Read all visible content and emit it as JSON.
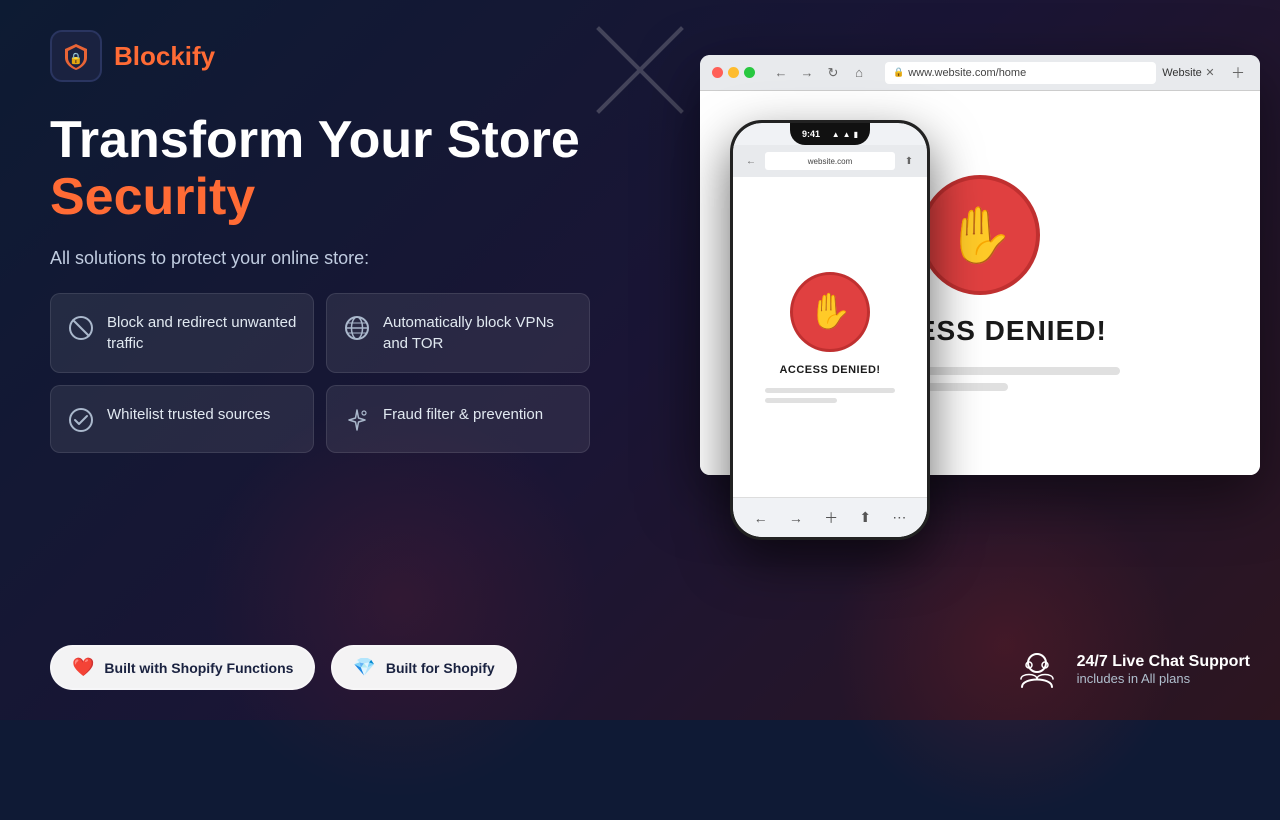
{
  "brand": {
    "name": "Blockify",
    "logo_alt": "Blockify Logo"
  },
  "hero": {
    "line1": "Transform Your Store",
    "line2": "Security",
    "subtitle": "All solutions to protect your online store:"
  },
  "features": [
    {
      "id": "block-traffic",
      "icon": "block-icon",
      "text": "Block and redirect unwanted traffic"
    },
    {
      "id": "block-vpn",
      "icon": "globe-icon",
      "text": "Automatically block VPNs and TOR"
    },
    {
      "id": "whitelist",
      "icon": "check-circle-icon",
      "text": "Whitelist trusted sources"
    },
    {
      "id": "fraud",
      "icon": "sparkle-icon",
      "text": "Fraud filter & prevention"
    }
  ],
  "badges": [
    {
      "id": "shopify-functions",
      "icon": "❤️",
      "text": "Built with Shopify Functions"
    },
    {
      "id": "built-shopify",
      "icon": "💎",
      "text": "Built for Shopify"
    }
  ],
  "browser": {
    "url": "www.website.com/home",
    "tab_title": "Website",
    "access_denied_text": "ACCESS DENIED!"
  },
  "phone": {
    "time": "9:41",
    "url": "website.com",
    "access_denied_text": "ACCESS DENIED!"
  },
  "support": {
    "title": "24/7 Live Chat Support",
    "subtitle": "includes in All plans"
  }
}
